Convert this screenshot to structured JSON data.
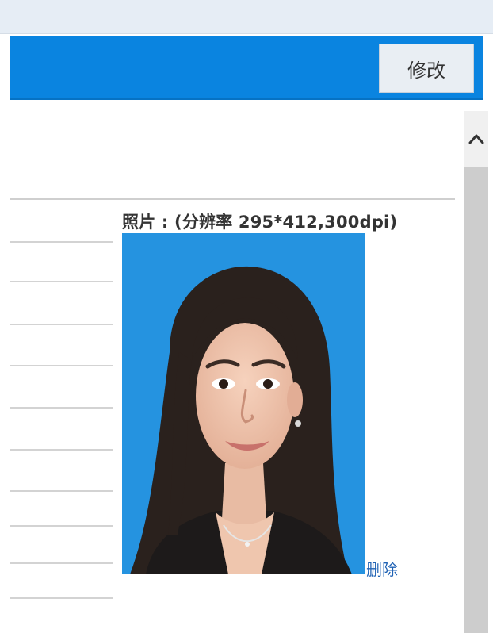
{
  "header": {
    "edit_button_label": "修改"
  },
  "photo": {
    "label": "照片 : (分辨率 295*412,300dpi)",
    "delete_link": "删除"
  },
  "colors": {
    "header_bar": "#0a84e0",
    "photo_background": "#2593e0",
    "link": "#1f62b4"
  },
  "icons": {
    "scroll_up": "chevron-up-icon"
  }
}
